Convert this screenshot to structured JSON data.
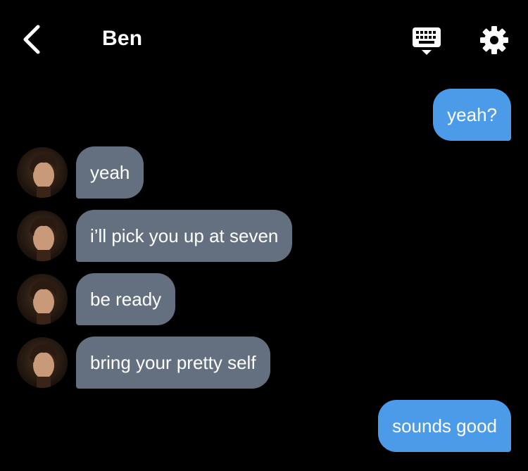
{
  "header": {
    "title": "Ben"
  },
  "icons": {
    "back": "chevron-left-icon",
    "keyboard": "keyboard-icon",
    "settings": "gear-icon"
  },
  "colors": {
    "background": "#000000",
    "incoming_bubble": "#647080",
    "outgoing_bubble": "#4c9be8",
    "text": "#ffffff"
  },
  "messages": [
    {
      "sender": "me",
      "text": "yeah?"
    },
    {
      "sender": "Ben",
      "text": "yeah"
    },
    {
      "sender": "Ben",
      "text": "i’ll pick you up at seven"
    },
    {
      "sender": "Ben",
      "text": "be ready"
    },
    {
      "sender": "Ben",
      "text": "bring your pretty self"
    },
    {
      "sender": "me",
      "text": "sounds good"
    }
  ]
}
